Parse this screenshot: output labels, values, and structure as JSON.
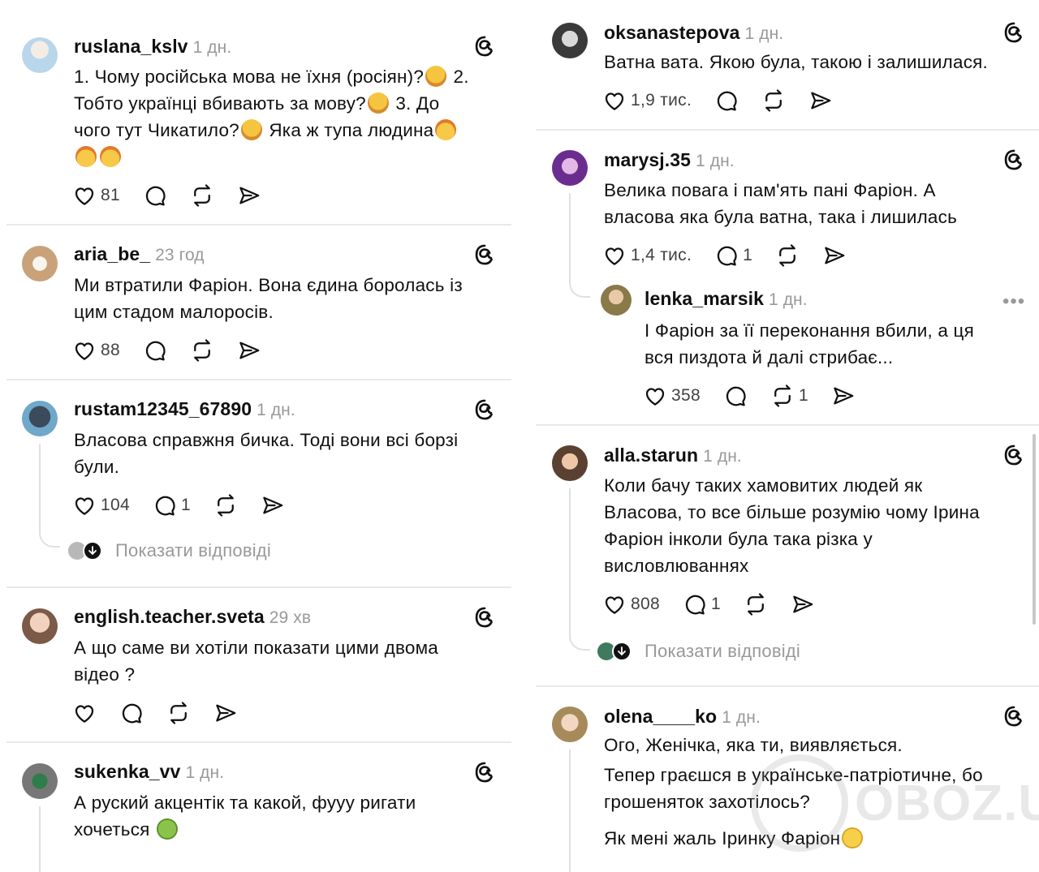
{
  "left": {
    "posts": [
      {
        "username": "ruslana_kslv",
        "time": "1 дн.",
        "lines": [
          "1. Чому російська мова не їхня (росіян)?",
          "2.",
          "Тобто українці вбивають за мову?",
          "3. До",
          "чого тут Чикатило?",
          "Яка ж тупа людина"
        ],
        "likes": "81"
      },
      {
        "username": "aria_be_",
        "time": "23 год",
        "lines": [
          "Ми втратили Фаріон. Вона єдина боролась із",
          "цим стадом малоросів."
        ],
        "likes": "88"
      },
      {
        "username": "rustam12345_67890",
        "time": "1 дн.",
        "lines": [
          "Власова справжня бичка. Тоді вони всі борзі",
          "були."
        ],
        "likes": "104",
        "replies": "1",
        "show_replies": "Показати відповіді"
      },
      {
        "username": "english.teacher.sveta",
        "time": "29 хв",
        "lines": [
          "А що саме ви хотіли показати цими двома",
          "відео ?"
        ]
      },
      {
        "username": "sukenka_vv",
        "time": "1 дн.",
        "lines": [
          "А руский акцентік та какой, фууу ригати",
          "хочеться"
        ]
      }
    ]
  },
  "right": {
    "posts": [
      {
        "username": "oksanastepova",
        "time": "1 дн.",
        "lines": [
          "Ватна вата. Якою була, такою і залишилася."
        ],
        "likes": "1,9 тис."
      },
      {
        "username": "marysj.35",
        "time": "1 дн.",
        "lines": [
          "Велика повага і пам'ять пані Фаріон. А",
          "власова яка була ватна, така і лишилась"
        ],
        "likes": "1,4 тис.",
        "replies": "1",
        "reply": {
          "username": "lenka_marsik",
          "time": "1 дн.",
          "more": "•••",
          "lines": [
            "І Фаріон за її переконання вбили, а ця",
            "вся пиздота й далі стрибає..."
          ],
          "likes": "358",
          "reposts": "1"
        }
      },
      {
        "username": "alla.starun",
        "time": "1 дн.",
        "lines": [
          "Коли бачу таких хамовитих людей як",
          "Власова, то все більше розумію чому Ірина",
          "Фаріон інколи була така різка у",
          "висловлюваннях"
        ],
        "likes": "808",
        "replies": "1",
        "show_replies": "Показати відповіді"
      },
      {
        "username": "olena____ko",
        "time": "1 дн.",
        "lines": [
          "Ого, Женічка, яка ти, виявляється.",
          "Тепер граєшся в українське-патріотичне, бо",
          "грошеняток захотілось?",
          "Як мені жаль Іринку Фаріон"
        ]
      }
    ]
  },
  "watermark": "OBOZ.UA",
  "colors": {
    "text": "#101010",
    "muted": "#999999",
    "divider": "#e9e9e9",
    "icon": "#101010"
  },
  "icons": [
    "threads-icon",
    "heart-icon",
    "comment-icon",
    "repost-icon",
    "share-icon",
    "more-icon"
  ]
}
